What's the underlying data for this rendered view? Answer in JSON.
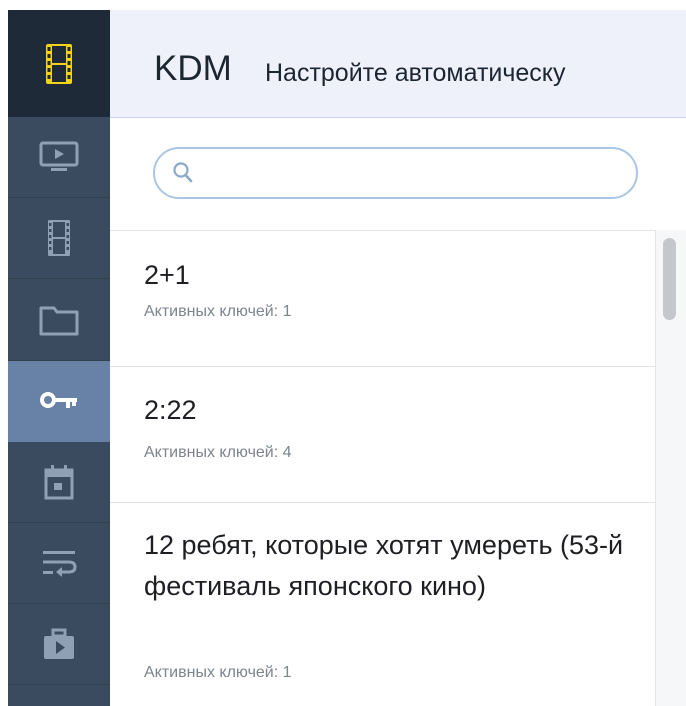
{
  "header": {
    "brand": "KDM",
    "subtitle": "Настройте автоматическу"
  },
  "search": {
    "placeholder": "",
    "value": ""
  },
  "sidebar": {
    "items": [
      {
        "icon": "film-logo-icon",
        "color": "#f2d21b"
      },
      {
        "icon": "tv-play-icon"
      },
      {
        "icon": "film-strip-icon"
      },
      {
        "icon": "folder-icon"
      },
      {
        "icon": "key-icon",
        "active": true
      },
      {
        "icon": "calendar-icon"
      },
      {
        "icon": "playlist-icon"
      },
      {
        "icon": "briefcase-play-icon"
      }
    ],
    "active_color": "#6782a6"
  },
  "films": [
    {
      "title": "2+1",
      "subtitle": "Активных ключей: 1"
    },
    {
      "title": "2:22",
      "subtitle": "Активных ключей: 4"
    },
    {
      "title": "12 ребят, которые хотят умереть (53-й фестиваль японского кино)",
      "subtitle": "Активных ключей: 1"
    }
  ]
}
